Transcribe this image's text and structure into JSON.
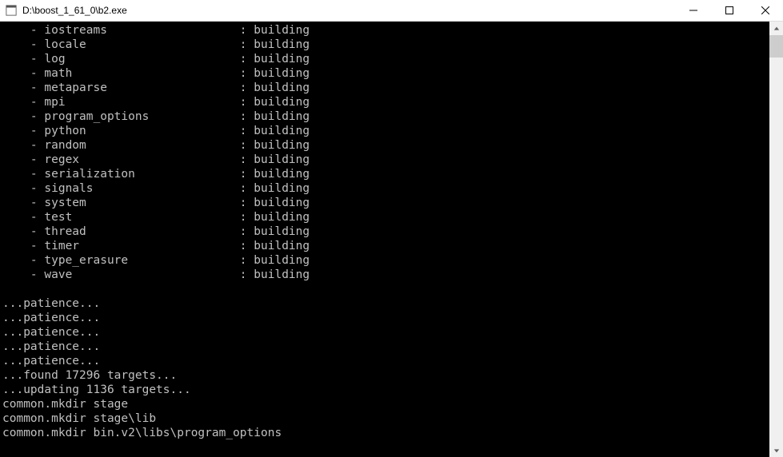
{
  "window": {
    "title": "D:\\boost_1_61_0\\b2.exe"
  },
  "components": [
    {
      "name": "iostreams",
      "status": "building"
    },
    {
      "name": "locale",
      "status": "building"
    },
    {
      "name": "log",
      "status": "building"
    },
    {
      "name": "math",
      "status": "building"
    },
    {
      "name": "metaparse",
      "status": "building"
    },
    {
      "name": "mpi",
      "status": "building"
    },
    {
      "name": "program_options",
      "status": "building"
    },
    {
      "name": "python",
      "status": "building"
    },
    {
      "name": "random",
      "status": "building"
    },
    {
      "name": "regex",
      "status": "building"
    },
    {
      "name": "serialization",
      "status": "building"
    },
    {
      "name": "signals",
      "status": "building"
    },
    {
      "name": "system",
      "status": "building"
    },
    {
      "name": "test",
      "status": "building"
    },
    {
      "name": "thread",
      "status": "building"
    },
    {
      "name": "timer",
      "status": "building"
    },
    {
      "name": "type_erasure",
      "status": "building"
    },
    {
      "name": "wave",
      "status": "building"
    }
  ],
  "status_lines": [
    "",
    "...patience...",
    "...patience...",
    "...patience...",
    "...patience...",
    "...patience...",
    "...found 17296 targets...",
    "...updating 1136 targets...",
    "common.mkdir stage",
    "common.mkdir stage\\lib",
    "common.mkdir bin.v2\\libs\\program_options"
  ]
}
